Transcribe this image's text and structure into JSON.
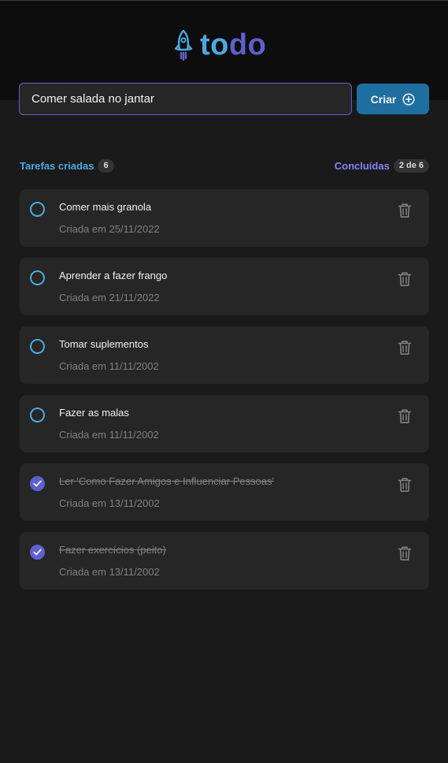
{
  "brand": {
    "part1": "to",
    "part2": "do",
    "color_primary": "#4ea8de",
    "color_secondary": "#5e60ce"
  },
  "new_task": {
    "value": "Comer salada no jantar",
    "placeholder": "",
    "button_label": "Criar"
  },
  "summary": {
    "created_label": "Tarefas criadas",
    "created_count": "6",
    "done_label": "Concluídas",
    "done_count": "2 de 6"
  },
  "tasks": [
    {
      "title": "Comer mais granola",
      "date": "Criada em 25/11/2022",
      "completed": false
    },
    {
      "title": "Aprender a fazer frango",
      "date": "Criada em 21/11/2022",
      "completed": false
    },
    {
      "title": "Tomar suplementos",
      "date": "Criada em 11/11/2002",
      "completed": false
    },
    {
      "title": "Fazer as malas",
      "date": "Criada em 11/11/2002",
      "completed": false
    },
    {
      "title": "Ler 'Como Fazer Amigos e Influenciar Pessoas'",
      "date": "Criada em 13/11/2002",
      "completed": true
    },
    {
      "title": "Fazer exercícios (peito)",
      "date": "Criada em 13/11/2002",
      "completed": true
    }
  ]
}
